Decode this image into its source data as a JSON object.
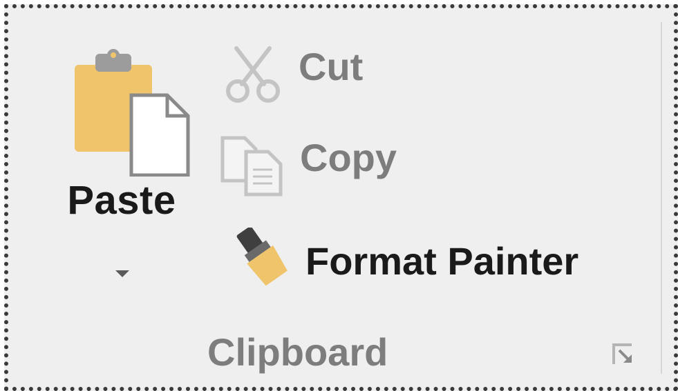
{
  "clipboard": {
    "paste": {
      "label": "Paste",
      "icon": "clipboard-paste-icon",
      "dropdown_icon": "caret-down-icon"
    },
    "commands": {
      "cut": {
        "label": "Cut",
        "icon": "scissors-icon"
      },
      "copy": {
        "label": "Copy",
        "icon": "copy-icon"
      },
      "format_painter": {
        "label": "Format Painter",
        "icon": "paintbrush-icon"
      }
    },
    "group_label": "Clipboard",
    "dialog_launcher_icon": "dialog-launcher-icon"
  },
  "colors": {
    "clipboard_gold": "#efc46b",
    "enabled_text": "#1a1a1a",
    "disabled_text": "#7d7d7d",
    "background": "#efefef"
  }
}
